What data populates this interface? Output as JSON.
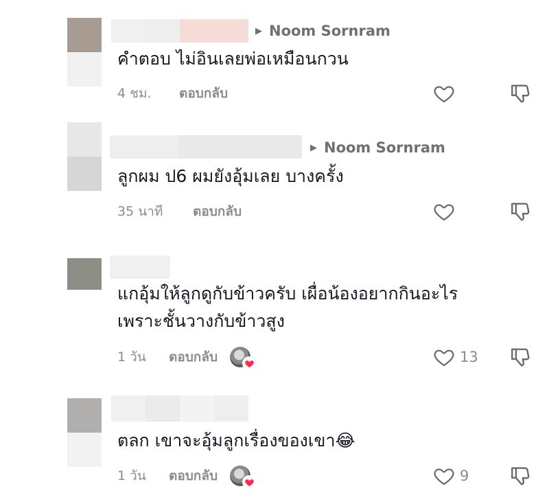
{
  "comments": [
    {
      "reply_to": "Noom Sornram",
      "text_lines": [
        "คำตอบ ไม่อินเลยพ่อเหมือนกวน"
      ],
      "time": "4 ชม.",
      "reply_label": "ตอบกลับ",
      "likes": "",
      "creator_liked": false
    },
    {
      "reply_to": "Noom Sornram",
      "text_lines": [
        "ลูกผม ป6 ผมยังอุ้มเลย บางครั้ง"
      ],
      "time": "35 นาที",
      "reply_label": "ตอบกลับ",
      "likes": "",
      "creator_liked": false
    },
    {
      "reply_to": "",
      "text_lines": [
        "แกอุ้มให้ลูกดูกับข้าวครับ เผื่อน้องอยากกินอะไร",
        "เพราะชั้นวางกับข้าวสูง"
      ],
      "time": "1 วัน",
      "reply_label": "ตอบกลับ",
      "likes": "13",
      "creator_liked": true
    },
    {
      "reply_to": "",
      "text_lines": [
        "ตลก เขาจะอุ้มลูกเรื่องของเขา😂"
      ],
      "time": "1 วัน",
      "reply_label": "ตอบกลับ",
      "likes": "9",
      "creator_liked": true
    }
  ],
  "icons": {
    "reply_arrow": "caret-right-icon",
    "like": "heart-outline-icon",
    "dislike": "thumbs-down-icon",
    "creator_heart": "heart-filled-icon"
  },
  "colors": {
    "text": "#161823",
    "secondary": "#8a8b91",
    "heart_red": "#fe2c55"
  }
}
